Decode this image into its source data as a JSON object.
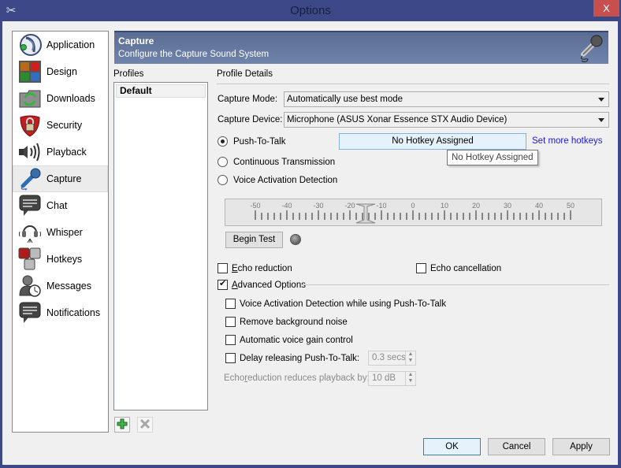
{
  "window": {
    "title": "Options",
    "close_label": "X"
  },
  "sidebar": {
    "items": [
      {
        "label": "Application",
        "icon": "teamspeak-logo-icon",
        "selected": false
      },
      {
        "label": "Design",
        "icon": "color-tiles-icon",
        "selected": false
      },
      {
        "label": "Downloads",
        "icon": "folder-sync-icon",
        "selected": false
      },
      {
        "label": "Security",
        "icon": "shield-lock-icon",
        "selected": false
      },
      {
        "label": "Playback",
        "icon": "speaker-icon",
        "selected": false
      },
      {
        "label": "Capture",
        "icon": "microphone-icon",
        "selected": true
      },
      {
        "label": "Chat",
        "icon": "chat-bubble-icon",
        "selected": false
      },
      {
        "label": "Whisper",
        "icon": "headset-icon",
        "selected": false
      },
      {
        "label": "Hotkeys",
        "icon": "keys-icon",
        "selected": false
      },
      {
        "label": "Messages",
        "icon": "user-clock-icon",
        "selected": false
      },
      {
        "label": "Notifications",
        "icon": "notification-bubble-icon",
        "selected": false
      }
    ]
  },
  "header": {
    "title": "Capture",
    "subtitle": "Configure the Capture Sound System",
    "icon": "microphone-icon"
  },
  "profiles": {
    "label": "Profiles",
    "items": [
      "Default"
    ],
    "selected": "Default",
    "add_icon": "plus-icon",
    "remove_icon": "x-icon"
  },
  "details": {
    "label": "Profile Details",
    "capture_mode": {
      "label": "Capture Mode:",
      "value": "Automatically use best mode"
    },
    "capture_device": {
      "label": "Capture Device:",
      "value": "Microphone (ASUS Xonar Essence STX Audio Device)"
    },
    "modes": [
      {
        "label": "Push-To-Talk",
        "checked": true
      },
      {
        "label": "Continuous Transmission",
        "checked": false
      },
      {
        "label": "Voice Activation Detection",
        "checked": false
      }
    ],
    "hotkey_button": "No Hotkey Assigned",
    "hotkey_link": "Set more hotkeys",
    "tooltip": "No Hotkey Assigned",
    "vad_meter": {
      "ticks": [
        "-50",
        "-40",
        "-30",
        "-20",
        "-10",
        "0",
        "10",
        "20",
        "30",
        "40",
        "50"
      ],
      "min": -50,
      "max": 50,
      "threshold": -15
    },
    "begin_test": "Begin Test",
    "echo_reduction": {
      "label_ul": "E",
      "label_rest": "cho reduction",
      "checked": false
    },
    "echo_cancellation": {
      "label": "Echo cancellation",
      "checked": false
    },
    "advanced": {
      "label_ul": "A",
      "label_rest": "dvanced Options",
      "checked": true,
      "vad_ptt": {
        "label": "Voice Activation Detection while using Push-To-Talk",
        "checked": false
      },
      "remove_noise": {
        "label": "Remove background noise",
        "checked": false
      },
      "agc": {
        "label": "Automatic voice gain control",
        "checked": false
      },
      "delay_ptt": {
        "label": "Delay releasing Push-To-Talk:",
        "checked": false,
        "value": "0.3 secs"
      },
      "echo_reduce_by": {
        "label_pre": "Echo ",
        "label_ul": "r",
        "label_rest": "eduction reduces playback by:",
        "value": "10 dB"
      }
    }
  },
  "buttons": {
    "ok": "OK",
    "cancel": "Cancel",
    "apply": "Apply"
  }
}
